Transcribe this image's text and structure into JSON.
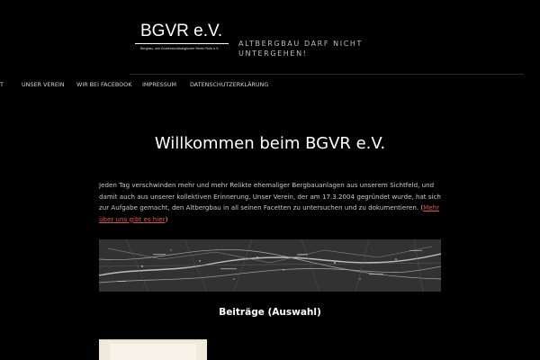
{
  "header": {
    "logo_title": "BGVR e.V.",
    "logo_subtitle": "Bergbau- und Grubenarchäologischer Verein Ruhr e.V.",
    "tagline": "ALTBERGBAU DARF NICHT UNTERGEHEN!"
  },
  "nav": {
    "items": [
      {
        "label": "ST"
      },
      {
        "label": "UNSER VEREIN"
      },
      {
        "label": "WIR BEI FACEBOOK"
      },
      {
        "label": "IMPRESSUM"
      },
      {
        "label": "DATENSCHUTZERKLÄRUNG"
      }
    ]
  },
  "main": {
    "title": "Willkommen beim BGVR e.V.",
    "intro": "Jeden Tag verschwinden mehr und mehr Relikte ehemaliger Bergbauanlagen aus unserem Sichtfeld, und damit auch aus unserer kollektiven Erinnerung. Unser Verein, der am 17.3.2004 gegründet wurde, hat sich zur Aufgabe gemacht, den Altbergbau in all seinen Facetten zu untersuchen und zu dokumentieren. (",
    "intro_link": "Mehr über uns gibt es hier",
    "intro_end": ")",
    "section_title": "Beiträge (Auswahl)"
  },
  "colors": {
    "background": "#000000",
    "text": "#c8c8c8",
    "link": "#e05050",
    "heading": "#ffffff"
  }
}
